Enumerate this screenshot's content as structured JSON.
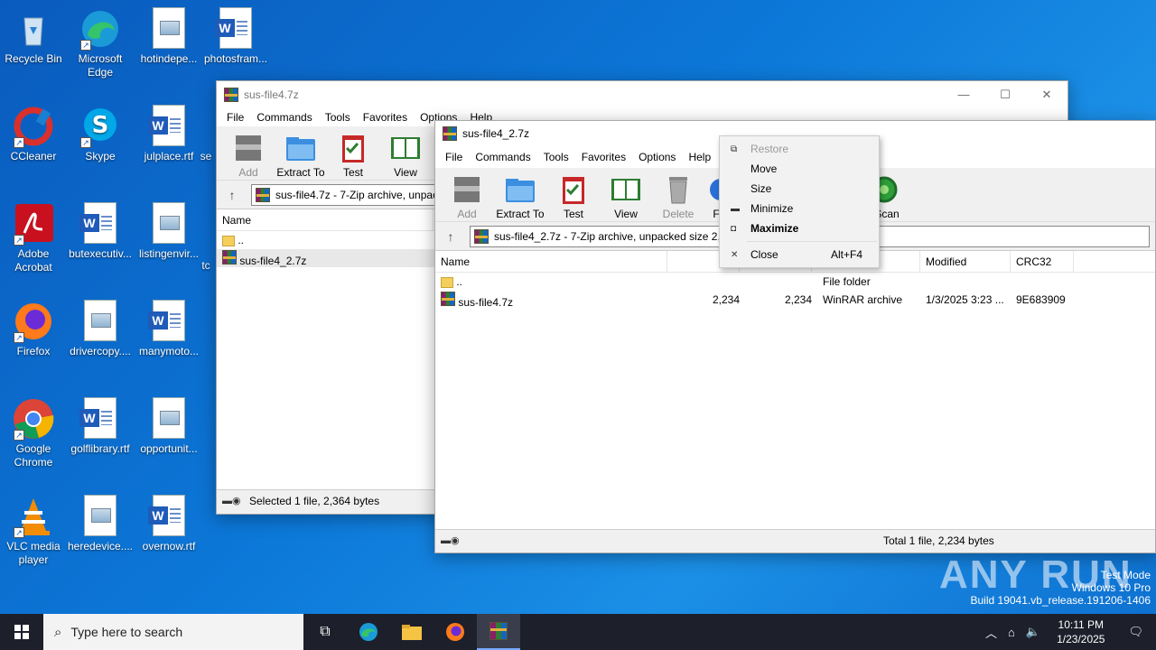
{
  "desktop": {
    "icons": [
      {
        "label": "Recycle Bin"
      },
      {
        "label": "Microsoft Edge"
      },
      {
        "label": "hotindepe..."
      },
      {
        "label": "photosfram..."
      },
      {
        "label": "CCleaner"
      },
      {
        "label": "Skype"
      },
      {
        "label": "julplace.rtf"
      },
      {
        "label": "se"
      },
      {
        "label": "Adobe Acrobat"
      },
      {
        "label": "butexecutiv..."
      },
      {
        "label": "listingenvir..."
      },
      {
        "label": "tc"
      },
      {
        "label": "Firefox"
      },
      {
        "label": "drivercopy...."
      },
      {
        "label": "manymoto..."
      },
      {
        "label": "Google Chrome"
      },
      {
        "label": "golflibrary.rtf"
      },
      {
        "label": "opportunit..."
      },
      {
        "label": "VLC media player"
      },
      {
        "label": "heredevice...."
      },
      {
        "label": "overnow.rtf"
      }
    ]
  },
  "back_window": {
    "title": "sus-file4.7z",
    "menu": [
      "File",
      "Commands",
      "Tools",
      "Favorites",
      "Options",
      "Help"
    ],
    "toolbar": [
      "Add",
      "Extract To",
      "Test",
      "View"
    ],
    "address": "sus-file4.7z - 7-Zip archive, unpacked size 2,364 bytes",
    "col_name": "Name",
    "rows": [
      {
        "name": ".."
      },
      {
        "name": "sus-file4_2.7z"
      }
    ],
    "status": "Selected 1 file, 2,364 bytes"
  },
  "front_window": {
    "title": "sus-file4_2.7z",
    "menu": [
      "File",
      "Commands",
      "Tools",
      "Favorites",
      "Options",
      "Help"
    ],
    "toolbar": [
      "Add",
      "Extract To",
      "Test",
      "View",
      "Delete",
      "F",
      "sScan"
    ],
    "address": "sus-file4_2.7z - 7-Zip archive, unpacked size 2,234 bytes",
    "columns": [
      "Name",
      "S",
      "",
      "",
      "Modified",
      "CRC32"
    ],
    "rows": [
      {
        "name": "..",
        "size": "",
        "packed": "",
        "type": "File folder",
        "modified": "",
        "crc": ""
      },
      {
        "name": "sus-file4.7z",
        "size": "2,234",
        "packed": "2,234",
        "type": "WinRAR archive",
        "modified": "1/3/2025 3:23 ...",
        "crc": "9E683909"
      }
    ],
    "status": "Total 1 file, 2,234 bytes"
  },
  "context_menu": {
    "restore": "Restore",
    "move": "Move",
    "size": "Size",
    "minimize": "Minimize",
    "maximize": "Maximize",
    "close": "Close",
    "close_accel": "Alt+F4"
  },
  "taskbar": {
    "search_placeholder": "Type here to search",
    "time": "10:11 PM",
    "date": "1/23/2025"
  },
  "watermark": {
    "brand": "ANY RUN",
    "line1": "Test Mode",
    "line2": "Windows 10 Pro",
    "line3": "Build 19041.vb_release.191206-1406"
  }
}
